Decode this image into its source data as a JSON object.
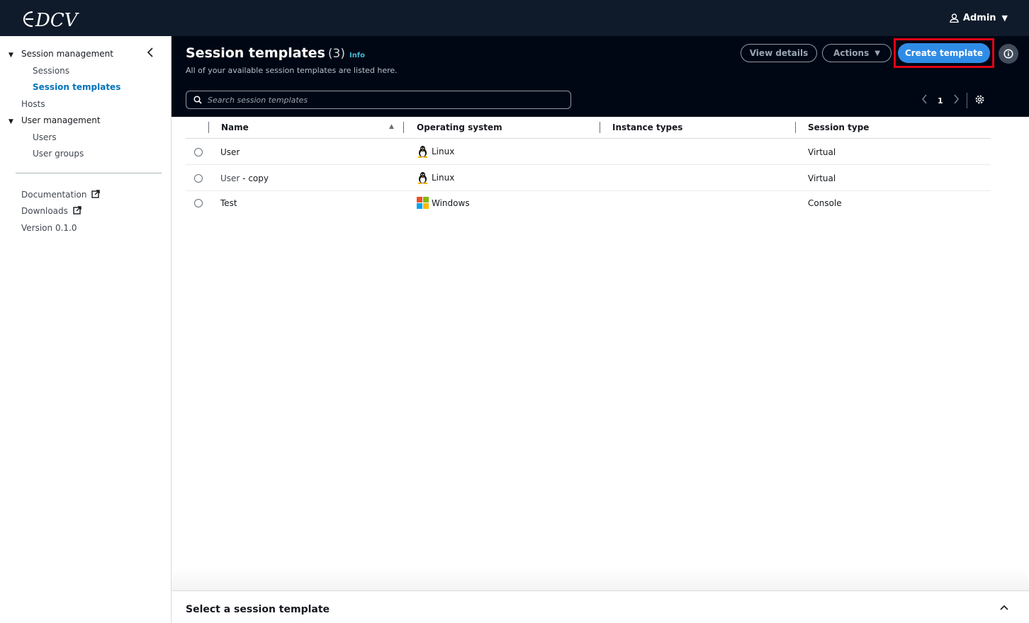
{
  "app": {
    "logo_text": "DCV"
  },
  "user_menu": {
    "label": "Admin"
  },
  "sidebar": {
    "groups": [
      {
        "label": "Session management",
        "items": [
          "Sessions",
          "Session templates"
        ]
      },
      {
        "label": "User management",
        "items": [
          "Users",
          "User groups"
        ]
      }
    ],
    "hosts_label": "Hosts",
    "documentation_label": "Documentation",
    "downloads_label": "Downloads",
    "version_label": "Version 0.1.0"
  },
  "header": {
    "title": "Session templates",
    "count": "(3)",
    "info_link": "Info",
    "description": "All of your available session templates are listed here.",
    "view_details_label": "View details",
    "actions_label": "Actions",
    "create_label": "Create template",
    "search_placeholder": "Search session templates",
    "page_number": "1"
  },
  "table": {
    "columns": [
      "Name",
      "Operating system",
      "Instance types",
      "Session type"
    ],
    "rows": [
      {
        "name": "User",
        "os": "Linux",
        "os_icon": "linux-icon",
        "instance_types": "",
        "session_type": "Virtual"
      },
      {
        "name_prefix": "User",
        "name_suffix": " - copy",
        "os": "Linux",
        "os_icon": "linux-icon",
        "instance_types": "",
        "session_type": "Virtual"
      },
      {
        "name": "Test",
        "os": "Windows",
        "os_icon": "windows-icon",
        "instance_types": "",
        "session_type": "Console"
      }
    ]
  },
  "bottom_panel": {
    "title": "Select a session template"
  },
  "colors": {
    "accent": "#2f8ce6",
    "header_bg": "#000714",
    "topbar_bg": "#0f1b2a",
    "highlight": "#e00414",
    "active_link": "#0073bb"
  }
}
